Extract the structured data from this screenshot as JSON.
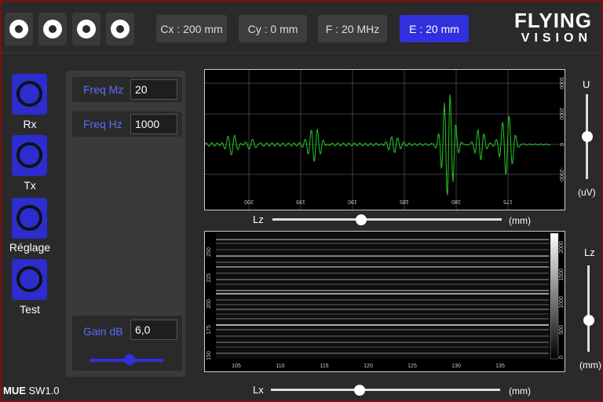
{
  "header": {
    "chips": [
      {
        "label": "Cx : 200 mm",
        "active": false
      },
      {
        "label": "Cy : 0 mm",
        "active": false
      },
      {
        "label": "F : 20 MHz",
        "active": false
      },
      {
        "label": "E : 20 mm",
        "active": true
      }
    ],
    "logo_line1": "FLYING",
    "logo_line2": "VISION",
    "ring_buttons": [
      "ring-icon",
      "ring-icon",
      "ring-icon",
      "ring-icon"
    ]
  },
  "sidebar": {
    "items": [
      {
        "label": "Rx",
        "icon": "ring-icon"
      },
      {
        "label": "Tx",
        "icon": "ring-icon"
      },
      {
        "label": "Réglage",
        "icon": "ring-icon"
      },
      {
        "label": "Test",
        "icon": "ring-icon"
      }
    ]
  },
  "params": {
    "freq_mz_label": "Freq Mz",
    "freq_mz_value": "20",
    "freq_hz_label": "Freq Hz",
    "freq_hz_value": "1000",
    "gain_label": "Gain dB",
    "gain_value": "6,0",
    "gain_slider": 0.55
  },
  "footer": {
    "product": "MUE",
    "version": "SW1.0"
  },
  "ascan": {
    "x_ticks": [
      "200",
      "195",
      "190",
      "185",
      "180",
      "175"
    ],
    "y_ticks": [
      "5000",
      "2000",
      "0",
      "-2000"
    ],
    "lz_label": "Lz",
    "lz_unit": "(mm)",
    "lz_slider": 0.38,
    "u_label": "U",
    "u_unit": "(uV)",
    "u_slider": 0.5,
    "trace_color": "#22cc22"
  },
  "bscan": {
    "x_ticks": [
      "105",
      "110",
      "115",
      "120",
      "125",
      "130",
      "135"
    ],
    "y_ticks": [
      "250",
      "225",
      "200",
      "175",
      "150"
    ],
    "colorbar_ticks": [
      "2000",
      "1500",
      "1000",
      "500",
      "0"
    ],
    "lx_label": "Lx",
    "lx_unit": "(mm)",
    "lx_slider": 0.38,
    "lz_label": "Lz",
    "lz_unit": "(mm)",
    "lz_slider": 0.66
  },
  "colors": {
    "accent": "#3030dd",
    "frame_border": "#7a1010",
    "label_blue": "#5a6cff"
  }
}
